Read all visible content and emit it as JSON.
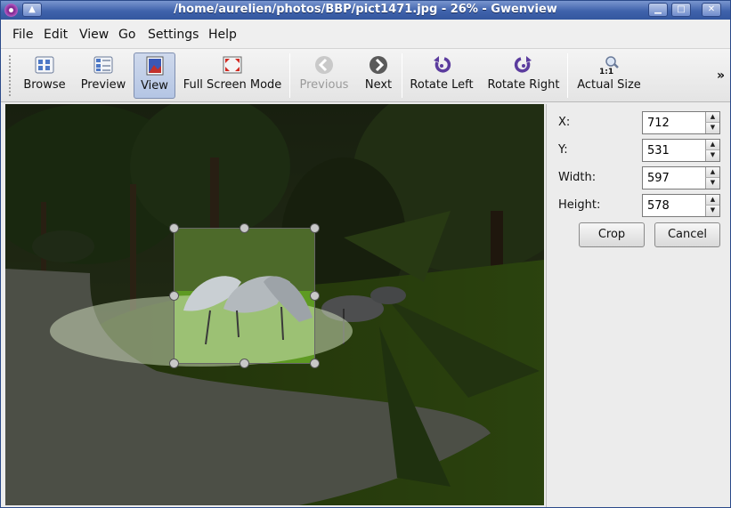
{
  "window": {
    "title": "/home/aurelien/photos/BBP/pict1471.jpg - 26% - Gwenview"
  },
  "menubar": {
    "items": [
      {
        "name": "menu-file",
        "label": "File"
      },
      {
        "name": "menu-edit",
        "label": "Edit"
      },
      {
        "name": "menu-view",
        "label": "View"
      },
      {
        "name": "menu-go",
        "label": "Go"
      },
      {
        "name": "menu-settings",
        "label": "Settings"
      },
      {
        "name": "menu-help",
        "label": "Help"
      }
    ]
  },
  "toolbar": {
    "browse": "Browse",
    "preview": "Preview",
    "view": "View",
    "fullscreen": "Full Screen Mode",
    "previous": "Previous",
    "next": "Next",
    "rotate_left": "Rotate Left",
    "rotate_right": "Rotate Right",
    "actual_size": "Actual Size",
    "more": "»",
    "active": "view",
    "disabled": [
      "previous"
    ]
  },
  "crop_panel": {
    "x_label": "X:",
    "x_value": "712",
    "y_label": "Y:",
    "y_value": "531",
    "width_label": "Width:",
    "width_value": "597",
    "height_label": "Height:",
    "height_value": "578",
    "crop_button": "Crop",
    "cancel_button": "Cancel"
  },
  "icons": {
    "close": "close-icon",
    "maximize": "maximize-icon",
    "minimize": "minimize-icon",
    "shade": "shade-icon"
  },
  "colors": {
    "titlebar": "#3f62ab",
    "active_button": "#b4c5e4"
  }
}
